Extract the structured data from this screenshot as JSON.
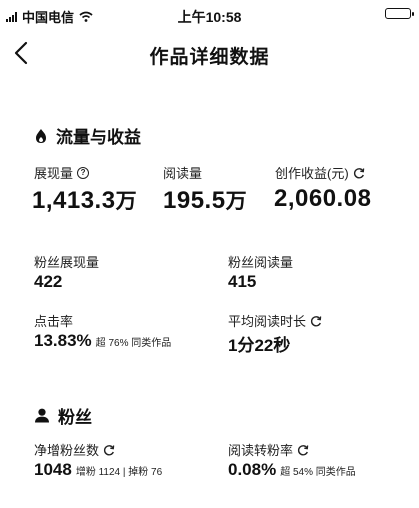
{
  "status_bar": {
    "carrier": "中国电信",
    "time": "上午10:58"
  },
  "nav": {
    "title": "作品详细数据"
  },
  "traffic": {
    "title": "流量与收益",
    "impressions": {
      "label": "展现量",
      "value": "1,413.3",
      "unit": "万"
    },
    "reads": {
      "label": "阅读量",
      "value": "195.5",
      "unit": "万"
    },
    "earnings": {
      "label": "创作收益(元)",
      "value": "2,060.08"
    },
    "fan_impressions": {
      "label": "粉丝展现量",
      "value": "422"
    },
    "fan_reads": {
      "label": "粉丝阅读量",
      "value": "415"
    },
    "ctr": {
      "label": "点击率",
      "value": "13.83%",
      "note": "超 76% 同类作品"
    },
    "avg_read_time": {
      "label": "平均阅读时长",
      "value": "1分22秒"
    }
  },
  "fans": {
    "title": "粉丝",
    "net_fans": {
      "label": "净增粉丝数",
      "value": "1048",
      "note": "增粉 1124 | 掉粉 76"
    },
    "conversion": {
      "label": "阅读转粉率",
      "value": "0.08%",
      "note": "超 54% 同类作品"
    }
  },
  "icons": [
    "signal-icon",
    "wifi-icon",
    "battery-icon",
    "back-arrow-icon",
    "flame-icon",
    "help-icon",
    "refresh-icon",
    "person-icon"
  ]
}
